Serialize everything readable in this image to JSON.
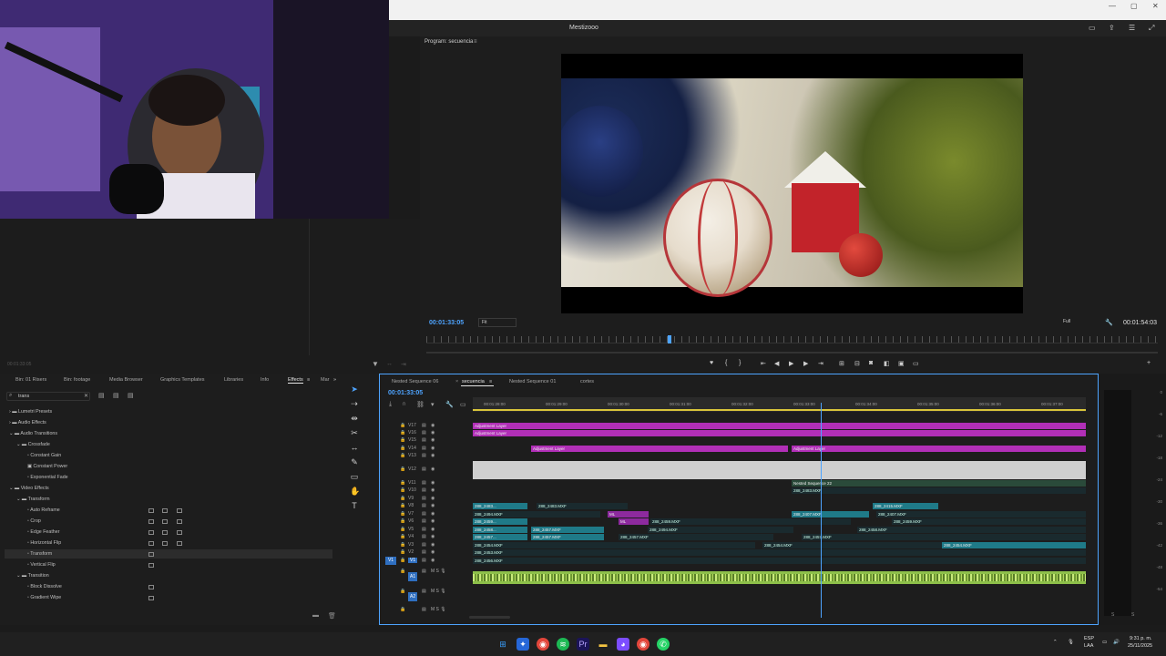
{
  "window": {
    "project_name": "Mestizooo",
    "controls": [
      "—",
      "▢",
      "✕"
    ]
  },
  "source_panel": {
    "timecode": "00:01:33:05"
  },
  "program": {
    "tab": "Program: secuencia",
    "timecode_left": "00:01:33:05",
    "fit": "Fit",
    "resolution": "Full",
    "timecode_right": "00:01:54:03",
    "playhead_fraction": 0.33
  },
  "effects_panel": {
    "tabs": [
      "Bin: 01 Risers",
      "Bin: footage",
      "Media Browser",
      "Graphics Templates",
      "Libraries",
      "Info",
      "Effects",
      "Mar"
    ],
    "active_tab": "Effects",
    "search_value": "trans",
    "tree": [
      {
        "label": "Lumetri Presets",
        "level": 0,
        "kind": "folder"
      },
      {
        "label": "Audio Effects",
        "level": 0,
        "kind": "folder"
      },
      {
        "label": "Audio Transitions",
        "level": 0,
        "kind": "folder"
      },
      {
        "label": "Crossfade",
        "level": 1,
        "kind": "folder"
      },
      {
        "label": "Constant Gain",
        "level": 2,
        "kind": "effect"
      },
      {
        "label": "Constant Power",
        "level": 2,
        "kind": "effect"
      },
      {
        "label": "Exponential Fade",
        "level": 2,
        "kind": "effect"
      },
      {
        "label": "Video Effects",
        "level": 0,
        "kind": "folder"
      },
      {
        "label": "Transform",
        "level": 1,
        "kind": "folder"
      },
      {
        "label": "Auto Reframe",
        "level": 2,
        "kind": "effect"
      },
      {
        "label": "Crop",
        "level": 2,
        "kind": "effect"
      },
      {
        "label": "Edge Feather",
        "level": 2,
        "kind": "effect"
      },
      {
        "label": "Horizontal Flip",
        "level": 2,
        "kind": "effect"
      },
      {
        "label": "Transform",
        "level": 2,
        "kind": "effect"
      },
      {
        "label": "Vertical Flip",
        "level": 2,
        "kind": "effect"
      },
      {
        "label": "Transition",
        "level": 1,
        "kind": "folder"
      },
      {
        "label": "Block Dissolve",
        "level": 2,
        "kind": "effect"
      },
      {
        "label": "Gradient Wipe",
        "level": 2,
        "kind": "effect"
      }
    ]
  },
  "timeline": {
    "tabs": [
      "Nested Sequence 06",
      "secuencia",
      "Nested Sequence 01",
      "cortes"
    ],
    "active_tab": "secuencia",
    "timecode": "00:01:33:05",
    "ruler_ticks": [
      "00:01:28:00",
      "00:01:29:00",
      "00:01:30:00",
      "00:01:31:00",
      "00:01:32:00",
      "00:01:33:00",
      "00:01:34:00",
      "00:01:35:00",
      "00:01:36:00",
      "00:01:37:00"
    ],
    "video_tracks": [
      "V17",
      "V16",
      "V15",
      "V14",
      "V13",
      "V12",
      "V11",
      "V10",
      "V9",
      "V8",
      "V7",
      "V6",
      "V5",
      "V4",
      "V3",
      "V2",
      "V1"
    ],
    "audio_tracks": [
      "A1",
      "A2"
    ],
    "clips": [
      {
        "label": "Adjustment Layer",
        "track": "V17",
        "type": "adj"
      },
      {
        "label": "Adjustment Layer",
        "track": "V16",
        "type": "adj"
      },
      {
        "label": "Adjustment Layer",
        "track": "V14",
        "type": "adj"
      },
      {
        "label": "Adjustment Layer",
        "track": "V14",
        "type": "adj"
      },
      {
        "label": "Nested Sequence 22",
        "track": "V11",
        "type": "nest"
      },
      {
        "label": "288_2483.MXF",
        "track": "V10",
        "type": "dark"
      },
      {
        "label": "288_2483...",
        "track": "V8",
        "type": "teal"
      },
      {
        "label": "288_2483.MXF",
        "track": "V8",
        "type": "dark"
      },
      {
        "label": "288_2415.MXF",
        "track": "V8",
        "type": "teal"
      },
      {
        "label": "288_2494.MXF",
        "track": "V7",
        "type": "dark"
      },
      {
        "label": "ML",
        "track": "V7",
        "type": "purp"
      },
      {
        "label": "288_2407.MXF",
        "track": "V7",
        "type": "teal"
      },
      {
        "label": "288_2407.MXF",
        "track": "V7",
        "type": "dark"
      },
      {
        "label": "288_2459...",
        "track": "V6",
        "type": "teal"
      },
      {
        "label": "ML",
        "track": "V6",
        "type": "purp"
      },
      {
        "label": "288_2459.MXF",
        "track": "V6",
        "type": "dark"
      },
      {
        "label": "288_2459.MXF",
        "track": "V6",
        "type": "dark"
      },
      {
        "label": "288_2458...",
        "track": "V5",
        "type": "teal"
      },
      {
        "label": "288_2457.MXF",
        "track": "V5",
        "type": "teal"
      },
      {
        "label": "288_2494.MXF",
        "track": "V5",
        "type": "dark"
      },
      {
        "label": "288_2458.MXF",
        "track": "V5",
        "type": "dark"
      },
      {
        "label": "288_2457...",
        "track": "V4",
        "type": "teal"
      },
      {
        "label": "288_2457.MXF",
        "track": "V4",
        "type": "teal"
      },
      {
        "label": "288_2457.MXF",
        "track": "V4",
        "type": "dark"
      },
      {
        "label": "288_2457.MXF",
        "track": "V4",
        "type": "dark"
      },
      {
        "label": "288_2454.MXF",
        "track": "V3",
        "type": "dark"
      },
      {
        "label": "288_2454.MXF",
        "track": "V3",
        "type": "dark"
      },
      {
        "label": "288_2454.MXF",
        "track": "V3",
        "type": "teal"
      },
      {
        "label": "288_2453.MXF",
        "track": "V2",
        "type": "dark"
      },
      {
        "label": "288_2456.MXF",
        "track": "V1",
        "type": "dark"
      }
    ]
  },
  "meters": {
    "scale": [
      "0",
      "-6",
      "-12",
      "-18",
      "-24",
      "-30",
      "-36",
      "-42",
      "-48",
      "-54"
    ],
    "bottom": [
      "S",
      "S"
    ]
  },
  "taskbar": {
    "lang_top": "ESP",
    "lang_bottom": "LAA",
    "time": "9:31 p. m.",
    "date": "25/11/2025"
  }
}
